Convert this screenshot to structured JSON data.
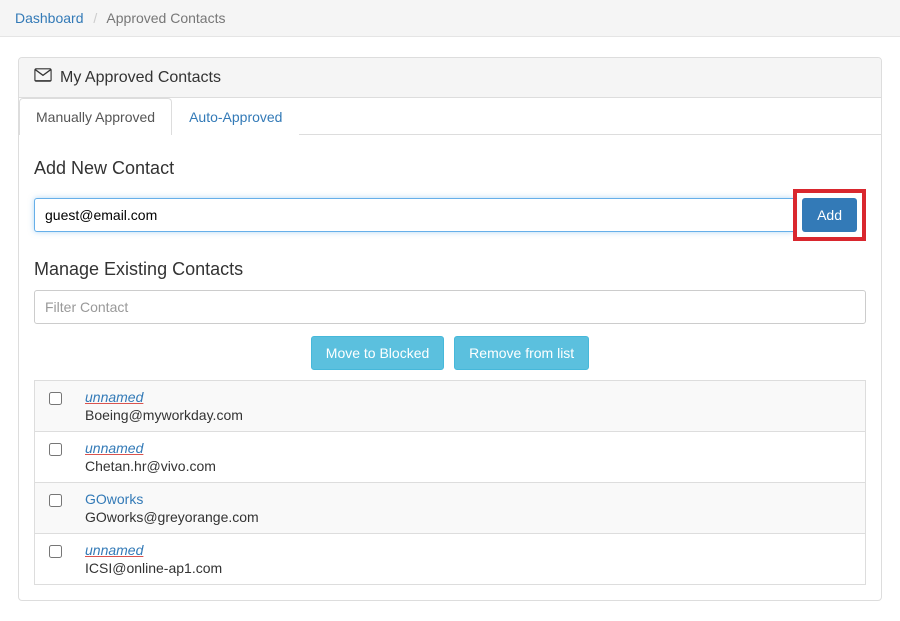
{
  "breadcrumb": {
    "dashboard": "Dashboard",
    "current": "Approved Contacts"
  },
  "panel": {
    "title": "My Approved Contacts"
  },
  "tabs": {
    "manual": "Manually Approved",
    "auto": "Auto-Approved"
  },
  "addSection": {
    "title": "Add New Contact",
    "value": "guest@email.com",
    "addLabel": "Add"
  },
  "manageSection": {
    "title": "Manage Existing Contacts",
    "filterPlaceholder": "Filter Contact",
    "moveBlocked": "Move to Blocked",
    "removeList": "Remove from list"
  },
  "contacts": [
    {
      "name": "unnamed",
      "email": "Boeing@myworkday.com",
      "isNamed": false
    },
    {
      "name": "unnamed",
      "email": "Chetan.hr@vivo.com",
      "isNamed": false
    },
    {
      "name": "GOworks",
      "email": "GOworks@greyorange.com",
      "isNamed": true
    },
    {
      "name": "unnamed",
      "email": "ICSI@online-ap1.com",
      "isNamed": false
    }
  ]
}
